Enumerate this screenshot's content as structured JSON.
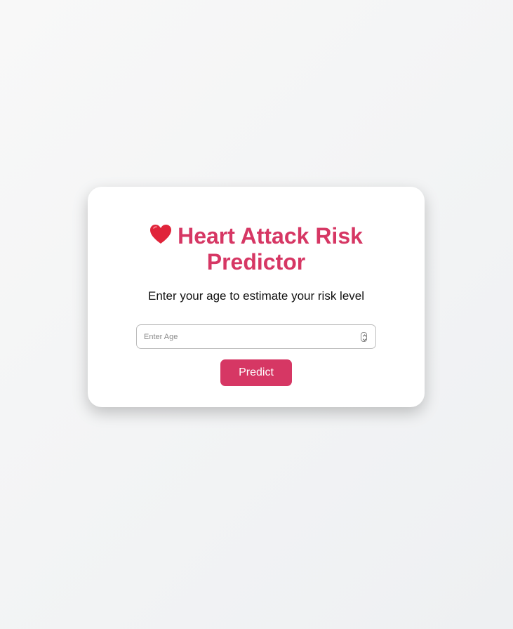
{
  "card": {
    "icon": "heart-icon",
    "title": "Heart Attack Risk Predictor",
    "subtitle": "Enter your age to estimate your risk level",
    "age_input": {
      "placeholder": "Enter Age",
      "value": ""
    },
    "predict_label": "Predict"
  },
  "colors": {
    "accent": "#d63764",
    "heart": "#e0243a",
    "background": "#f4f5f6",
    "card": "#ffffff"
  }
}
